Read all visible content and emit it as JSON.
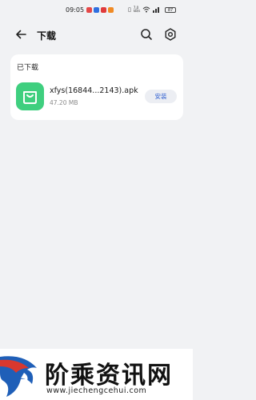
{
  "status_bar": {
    "time": "09:05",
    "net_speed_value": "7.0",
    "net_speed_unit": "kB/s",
    "battery": "87"
  },
  "header": {
    "title": "下载"
  },
  "downloads": {
    "section_title": "已下载",
    "items": [
      {
        "file_name": "xfys(16844...2143).apk",
        "file_size": "47.20 MB",
        "action_label": "安装"
      }
    ]
  },
  "watermark": {
    "site_name": "阶乘资讯网",
    "url": "www.jiechengcehui.com"
  },
  "colors": {
    "app_icon": "#3fcf7f",
    "install_text": "#2f5fd0",
    "background": "#f1f2f4"
  }
}
